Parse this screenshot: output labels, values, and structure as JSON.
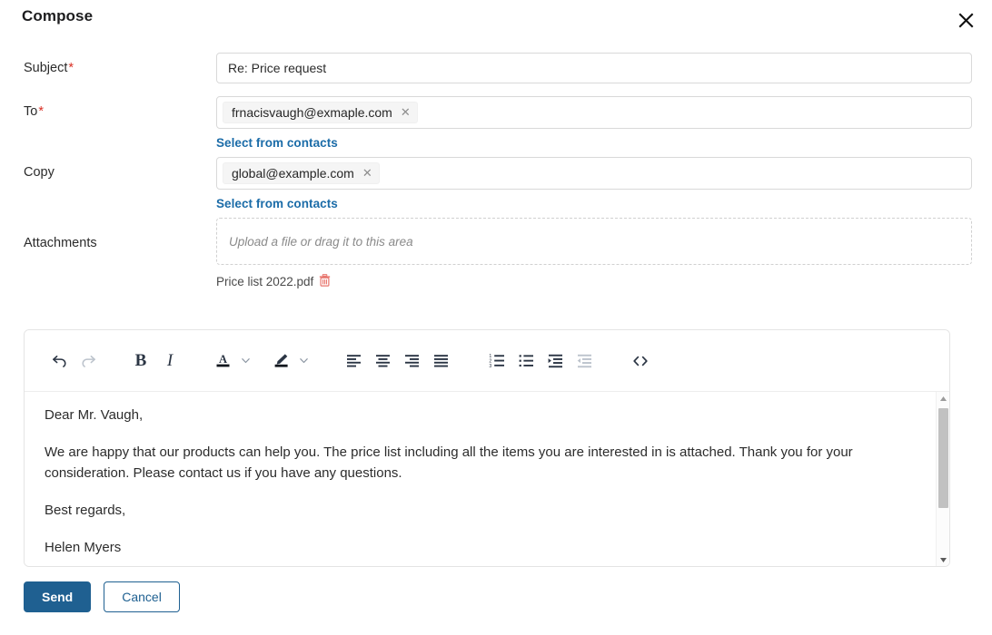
{
  "window": {
    "title": "Compose",
    "close_icon": "close-icon"
  },
  "form": {
    "subject": {
      "label": "Subject",
      "required_mark": "*",
      "value": "Re: Price request"
    },
    "to": {
      "label": "To",
      "required_mark": "*",
      "recipients": [
        {
          "email": "frnacisvaugh@exmaple.com",
          "remove_icon": "close-icon"
        }
      ],
      "contacts_link": "Select from contacts"
    },
    "copy": {
      "label": "Copy",
      "recipients": [
        {
          "email": "global@example.com",
          "remove_icon": "close-icon"
        }
      ],
      "contacts_link": "Select from contacts"
    },
    "attachments": {
      "label": "Attachments",
      "dropzone_text": "Upload a file or drag it to this area",
      "files": [
        {
          "name": "Price list 2022.pdf",
          "delete_icon": "trash-icon"
        }
      ]
    }
  },
  "editor": {
    "toolbar": [
      {
        "name": "undo-icon",
        "label": "Undo",
        "disabled": false
      },
      {
        "name": "redo-icon",
        "label": "Redo",
        "disabled": true
      },
      {
        "name": "bold-icon",
        "label": "Bold",
        "disabled": false
      },
      {
        "name": "italic-icon",
        "label": "Italic",
        "disabled": false
      },
      {
        "name": "text-color-icon",
        "label": "Text color",
        "disabled": false
      },
      {
        "name": "text-color-caret-icon",
        "label": "Text color menu",
        "disabled": false
      },
      {
        "name": "highlight-icon",
        "label": "Highlight",
        "disabled": false
      },
      {
        "name": "highlight-caret-icon",
        "label": "Highlight menu",
        "disabled": false
      },
      {
        "name": "align-left-icon",
        "label": "Align left",
        "disabled": false
      },
      {
        "name": "align-center-icon",
        "label": "Align center",
        "disabled": false
      },
      {
        "name": "align-right-icon",
        "label": "Align right",
        "disabled": false
      },
      {
        "name": "align-justify-icon",
        "label": "Justify",
        "disabled": false
      },
      {
        "name": "ordered-list-icon",
        "label": "Numbered list",
        "disabled": false
      },
      {
        "name": "bullet-list-icon",
        "label": "Bulleted list",
        "disabled": false
      },
      {
        "name": "indent-icon",
        "label": "Increase indent",
        "disabled": false
      },
      {
        "name": "outdent-icon",
        "label": "Decrease indent",
        "disabled": true
      },
      {
        "name": "code-icon",
        "label": "Source code",
        "disabled": false
      }
    ],
    "body": [
      "Dear Mr. Vaugh,",
      "We are happy that our products can help you. The price list including all the items you are interested in is attached. Thank you for your consideration. Please contact us if you have any questions.",
      "Best regards,",
      "Helen Myers"
    ],
    "scrollbar": {
      "up_icon": "caret-up-icon",
      "down_icon": "caret-down-icon"
    }
  },
  "footer": {
    "send_label": "Send",
    "cancel_label": "Cancel"
  },
  "colors": {
    "accent": "#1f6091",
    "link": "#1b6ca8",
    "required": "#d93025",
    "delete": "#e8756d",
    "toolbar_icon": "#2b3544",
    "toolbar_icon_disabled": "#bcc3cc"
  }
}
